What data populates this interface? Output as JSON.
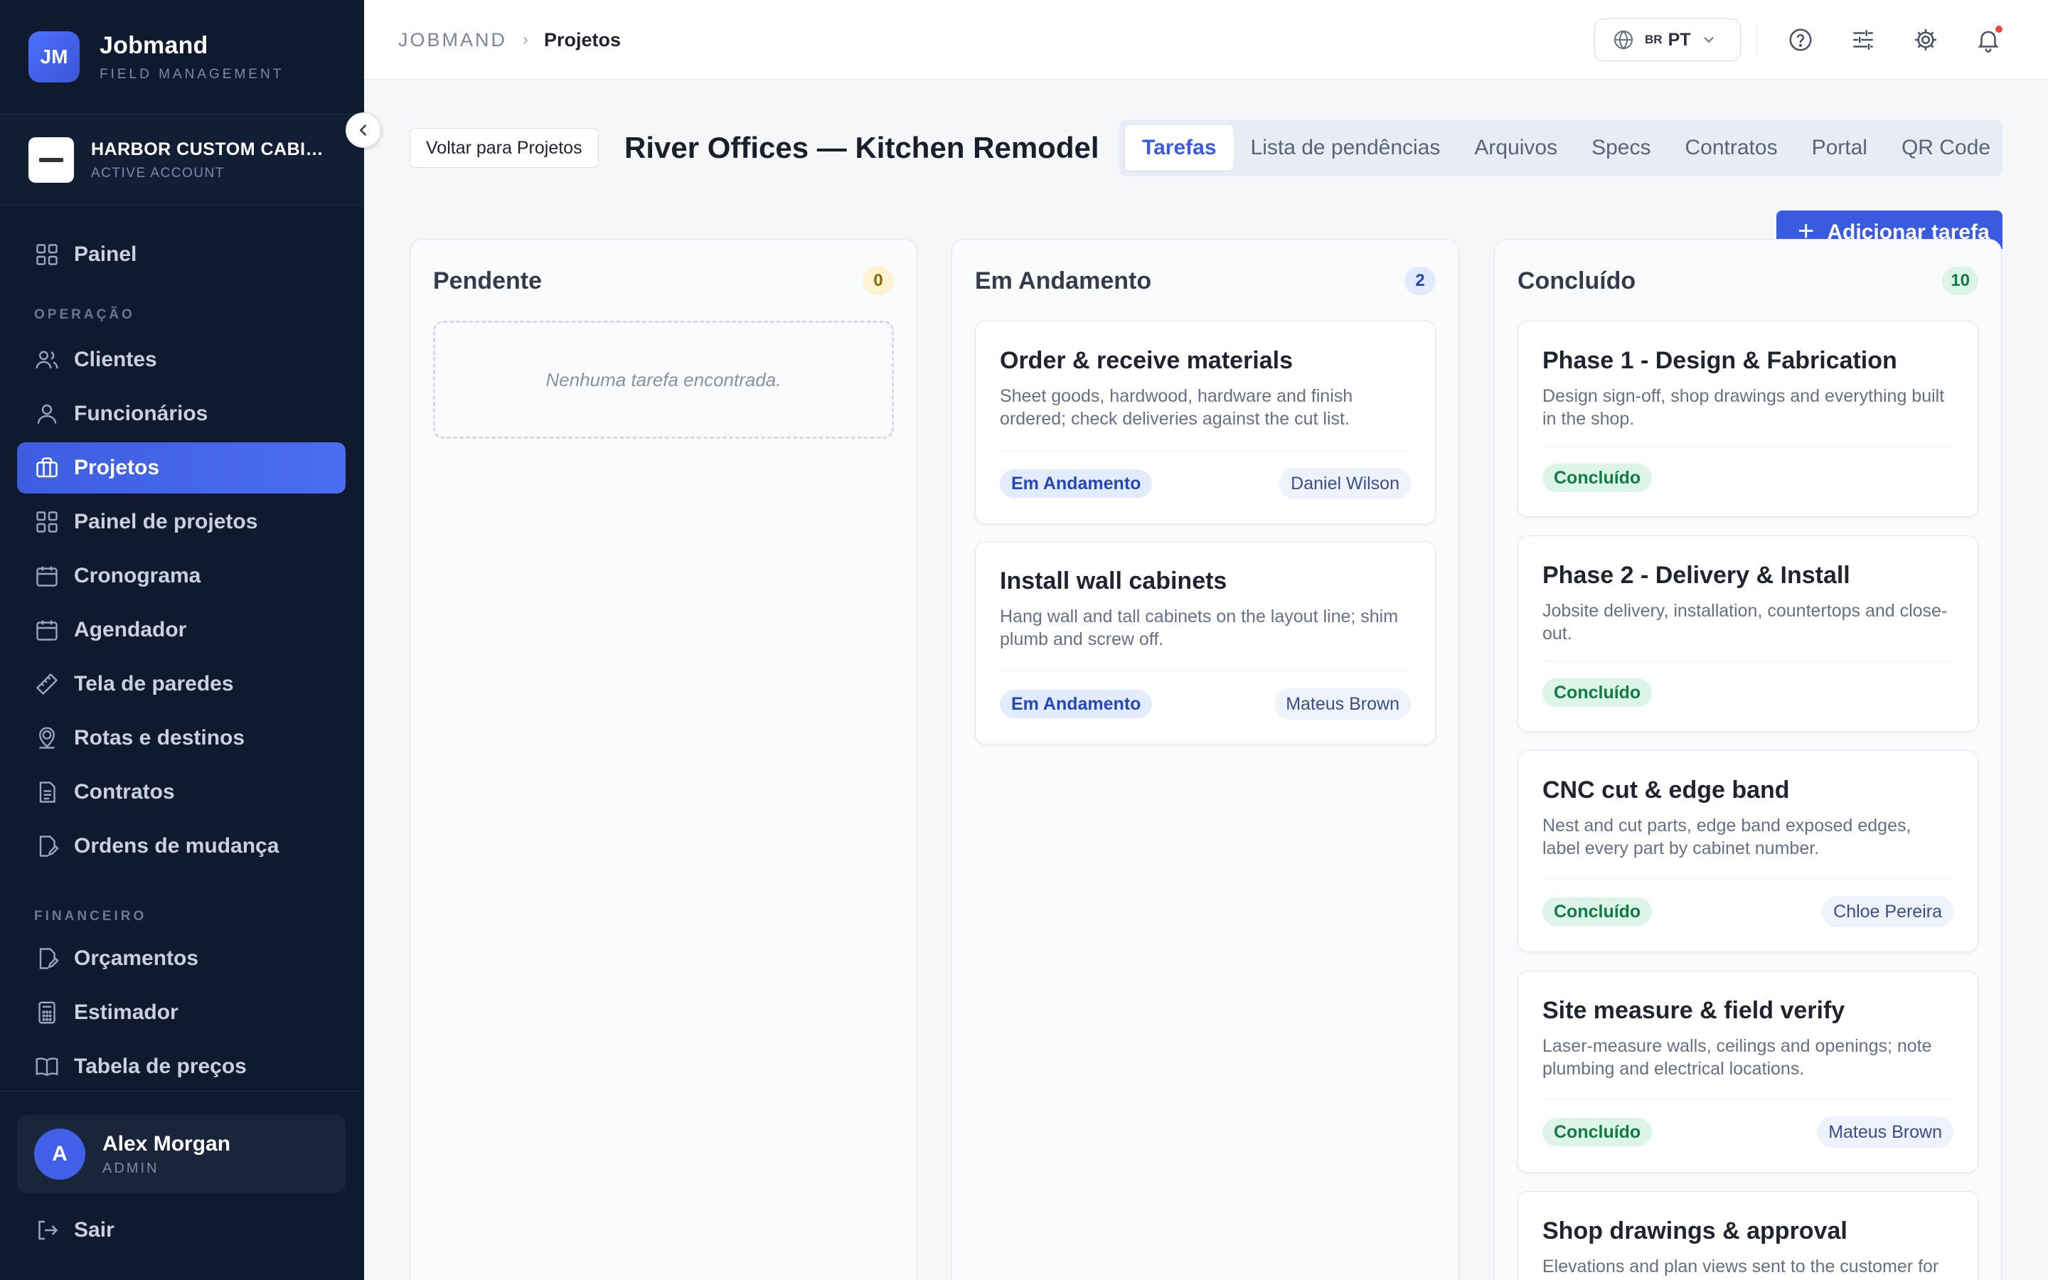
{
  "brand": {
    "initials": "JM",
    "name": "Jobmand",
    "subtitle": "FIELD MANAGEMENT"
  },
  "account": {
    "name": "HARBOR CUSTOM CABIN...",
    "status": "ACTIVE ACCOUNT"
  },
  "sidebar": {
    "items": [
      {
        "label": "Painel",
        "icon": "grid-icon"
      },
      {
        "label": "Clientes",
        "icon": "users-icon"
      },
      {
        "label": "Funcionários",
        "icon": "user-icon"
      },
      {
        "label": "Projetos",
        "icon": "briefcase-icon",
        "active": true
      },
      {
        "label": "Painel de projetos",
        "icon": "grid-icon"
      },
      {
        "label": "Cronograma",
        "icon": "calendar-icon"
      },
      {
        "label": "Agendador",
        "icon": "calendar-icon"
      },
      {
        "label": "Tela de paredes",
        "icon": "ruler-icon"
      },
      {
        "label": "Rotas e destinos",
        "icon": "map-pin-icon"
      },
      {
        "label": "Contratos",
        "icon": "document-icon"
      },
      {
        "label": "Ordens de mudança",
        "icon": "document-edit-icon"
      },
      {
        "label": "Orçamentos",
        "icon": "document-edit-icon"
      },
      {
        "label": "Estimador",
        "icon": "calculator-icon"
      },
      {
        "label": "Tabela de preços",
        "icon": "book-icon"
      }
    ],
    "sections": {
      "operacao": "OPERAÇÃO",
      "financeiro": "FINANCEIRO"
    }
  },
  "user": {
    "initial": "A",
    "name": "Alex Morgan",
    "role": "ADMIN"
  },
  "logout_label": "Sair",
  "breadcrumb": {
    "root": "JOBMAND",
    "current": "Projetos"
  },
  "language": {
    "flag": "BR",
    "code": "PT"
  },
  "header": {
    "back_label": "Voltar para Projetos",
    "title": "River Offices — Kitchen Remodel",
    "add_task_label": "Adicionar tarefa"
  },
  "tabs": [
    {
      "label": "Tarefas",
      "active": true
    },
    {
      "label": "Lista de pendências"
    },
    {
      "label": "Arquivos"
    },
    {
      "label": "Specs"
    },
    {
      "label": "Contratos"
    },
    {
      "label": "Portal"
    },
    {
      "label": "QR Code"
    }
  ],
  "columns": {
    "pending": {
      "title": "Pendente",
      "count": "0",
      "empty": "Nenhuma tarefa encontrada.",
      "badge_bg": "#fdf3d0",
      "badge_fg": "#8a6a06"
    },
    "in_progress": {
      "title": "Em Andamento",
      "count": "2",
      "badge_bg": "#e1ebfd",
      "badge_fg": "#2447b8",
      "cards": [
        {
          "title": "Order & receive materials",
          "description": "Sheet goods, hardwood, hardware and finish ordered; check deliveries against the cut list.",
          "status": "Em Andamento",
          "assignee": "Daniel Wilson"
        },
        {
          "title": "Install wall cabinets",
          "description": "Hang wall and tall cabinets on the layout line; shim plumb and screw off.",
          "status": "Em Andamento",
          "assignee": "Mateus Brown"
        }
      ]
    },
    "done": {
      "title": "Concluído",
      "count": "10",
      "badge_bg": "#dcf5e8",
      "badge_fg": "#127a46",
      "cards": [
        {
          "title": "Phase 1 - Design & Fabrication",
          "description": "Design sign-off, shop drawings and everything built in the shop.",
          "status": "Concluído",
          "assignee": ""
        },
        {
          "title": "Phase 2 - Delivery & Install",
          "description": "Jobsite delivery, installation, countertops and close-out.",
          "status": "Concluído",
          "assignee": ""
        },
        {
          "title": "CNC cut & edge band",
          "description": "Nest and cut parts, edge band exposed edges, label every part by cabinet number.",
          "status": "Concluído",
          "assignee": "Chloe Pereira"
        },
        {
          "title": "Site measure & field verify",
          "description": "Laser-measure walls, ceilings and openings; note plumbing and electrical locations.",
          "status": "Concluído",
          "assignee": "Mateus Brown"
        },
        {
          "title": "Shop drawings & approval",
          "description": "Elevations and plan views sent to the customer for",
          "status": "",
          "assignee": ""
        }
      ]
    }
  },
  "colors": {
    "sidebar_bg": "#0f1a2e",
    "accent": "#3a5be0",
    "danger": "#ef4444"
  }
}
